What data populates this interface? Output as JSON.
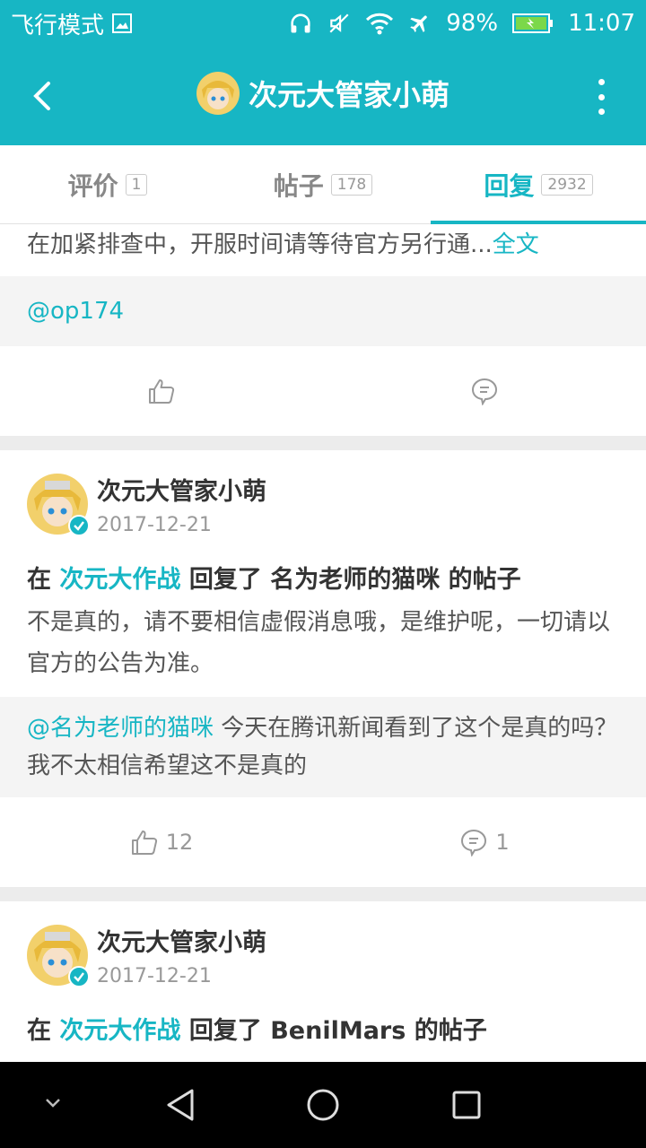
{
  "status_bar": {
    "mode": "飞行模式",
    "battery": "98%",
    "time": "11:07"
  },
  "app_bar": {
    "title": "次元大管家小萌"
  },
  "tabs": [
    {
      "label": "评价",
      "count": "1"
    },
    {
      "label": "帖子",
      "count": "178"
    },
    {
      "label": "回复",
      "count": "2932"
    }
  ],
  "partial_card": {
    "text": "在加紧排查中，开服时间请等待官方另行通...",
    "more_link": "全文",
    "quote": "@op174",
    "like_count": "",
    "comment_count": ""
  },
  "cards": [
    {
      "user": "次元大管家小萌",
      "date": "2017-12-21",
      "prefix": "在",
      "forum": "次元大作战",
      "action": "回复了",
      "target": "名为老师的猫咪 的帖子",
      "body": "不是真的，请不要相信虚假消息哦，是维护呢，一切请以官方的公告为准。",
      "quote_user": "@名为老师的猫咪",
      "quote_text": " 今天在腾讯新闻看到了这个是真的吗？我不太相信希望这不是真的",
      "like_count": "12",
      "comment_count": "1"
    },
    {
      "user": "次元大管家小萌",
      "date": "2017-12-21",
      "prefix": "在",
      "forum": "次元大作战",
      "action": "回复了",
      "target": "BenilMars 的帖子"
    }
  ],
  "colors": {
    "accent": "#17b6c4",
    "nav_bg": "#000000"
  },
  "icons": [
    "back-arrow-icon",
    "more-vertical-icon",
    "thumb-up-icon",
    "comment-icon",
    "verified-icon",
    "nav-back-icon",
    "nav-home-icon",
    "nav-recent-icon",
    "nav-down-icon"
  ]
}
